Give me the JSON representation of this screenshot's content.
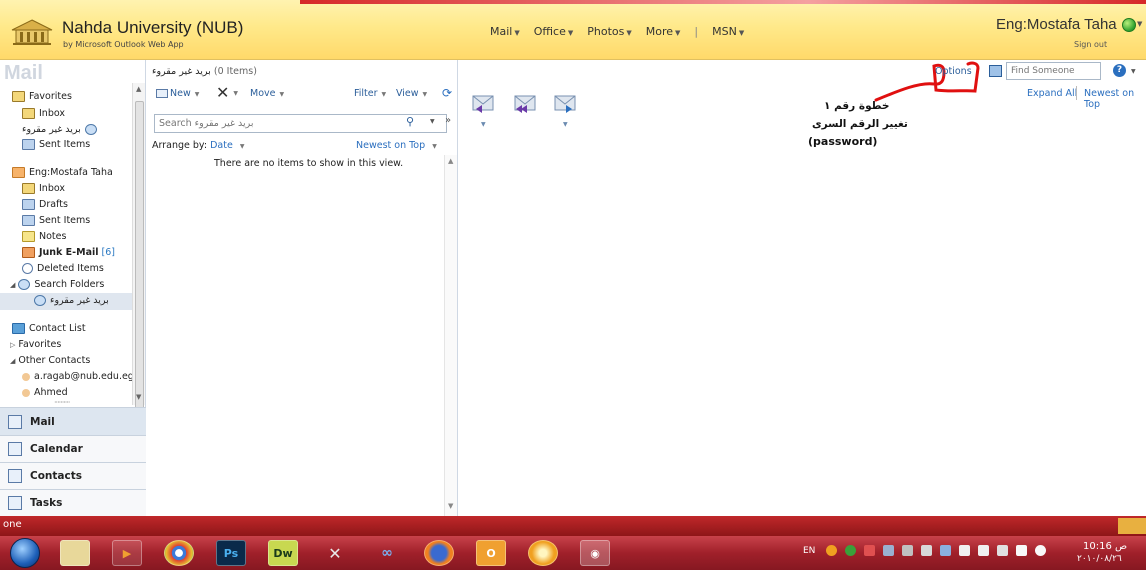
{
  "header": {
    "org_name": "Nahda University (NUB)",
    "org_sub": "by Microsoft Outlook Web App",
    "nav": [
      {
        "label": "Mail",
        "has_menu": true
      },
      {
        "label": "Office",
        "has_menu": true
      },
      {
        "label": "Photos",
        "has_menu": true
      },
      {
        "label": "More",
        "has_menu": true
      },
      {
        "label": "MSN",
        "has_menu": true
      }
    ],
    "nav_separator": "|",
    "user_name": "Eng:Mostafa Taha",
    "sign_out": "Sign out",
    "colors": {
      "header_yellow": "#ffe98a",
      "presence_green": "#2ea12e"
    }
  },
  "left_nav": {
    "watermark": "Mail",
    "favorites": {
      "label": "Favorites",
      "items": [
        {
          "label": "Inbox",
          "icon": "inbox-icon"
        },
        {
          "label": "بريد غير مقروء",
          "icon": "search-folder-icon"
        },
        {
          "label": "Sent Items",
          "icon": "sent-items-icon"
        }
      ]
    },
    "mailbox": {
      "label": "Eng:Mostafa Taha",
      "items": [
        {
          "label": "Inbox",
          "icon": "inbox-icon"
        },
        {
          "label": "Drafts",
          "icon": "drafts-icon"
        },
        {
          "label": "Sent Items",
          "icon": "sent-items-icon"
        },
        {
          "label": "Notes",
          "icon": "notes-icon"
        },
        {
          "label": "Junk E-Mail",
          "count": "[6]",
          "icon": "junk-icon"
        },
        {
          "label": "Deleted Items",
          "icon": "deleted-items-icon"
        },
        {
          "label": "Search Folders",
          "icon": "search-folder-icon"
        },
        {
          "label": "بريد غير مقروء",
          "icon": "search-folder-icon",
          "selected": true
        }
      ]
    },
    "contacts": {
      "list_label": "Contact List",
      "favorites_label": "Favorites",
      "other_label": "Other Contacts",
      "people": [
        "a.ragab@nub.edu.eg",
        "Ahmed"
      ]
    },
    "big_nav": [
      {
        "label": "Mail",
        "icon": "mail-icon",
        "active": true
      },
      {
        "label": "Calendar",
        "icon": "calendar-icon"
      },
      {
        "label": "Contacts",
        "icon": "contacts-icon"
      },
      {
        "label": "Tasks",
        "icon": "tasks-icon"
      }
    ]
  },
  "list_pane": {
    "folder_title": "بريد غير مقروء",
    "item_count": "(0 Items)",
    "toolbar": {
      "new_label": "New",
      "move_label": "Move",
      "filter_label": "Filter",
      "view_label": "View"
    },
    "search_placeholder": "Search بريد غير مقروء",
    "arrange_label": "Arrange by:",
    "arrange_value": "Date",
    "sort_label": "Newest on Top",
    "empty_message": "There are no items to show in this view."
  },
  "reading_pane": {
    "options_label": "Options",
    "find_placeholder": "Find Someone",
    "expand_all": "Expand All",
    "newest_on_top": "Newest on Top",
    "annotation": {
      "line1": "خطوة رقم ١",
      "line2": "تغيير الرقم السرى",
      "line3": "(password)"
    }
  },
  "status_band": {
    "label": "one"
  },
  "taskbar": {
    "apps": [
      "folder",
      "media",
      "chrome",
      "photoshop",
      "dreamweaver",
      "tools",
      "messenger",
      "firefox",
      "outlook",
      "opera",
      "chat"
    ],
    "apps_labels": {
      "photoshop": "Ps",
      "dreamweaver": "Dw"
    },
    "lang": "EN",
    "time": "10:16 ص",
    "date": "٢٠١٠/٠٨/٢٦"
  }
}
